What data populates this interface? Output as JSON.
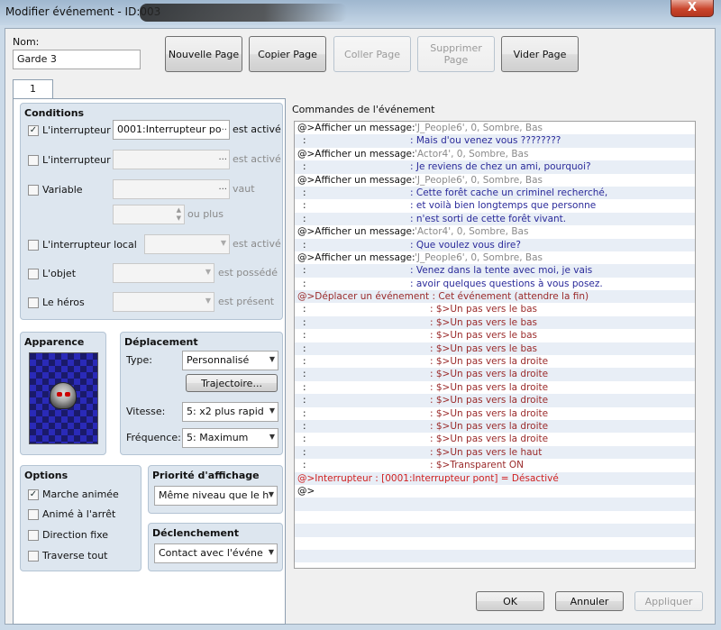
{
  "window": {
    "title": "Modifier événement - ID:003",
    "close": "X"
  },
  "name_field": {
    "label": "Nom:",
    "value": "Garde 3"
  },
  "top_buttons": [
    {
      "label": "Nouvelle Page",
      "enabled": true
    },
    {
      "label": "Copier Page",
      "enabled": true
    },
    {
      "label": "Coller Page",
      "enabled": false
    },
    {
      "label": "Supprimer Page",
      "enabled": false
    },
    {
      "label": "Vider Page",
      "enabled": true
    }
  ],
  "tab": {
    "label": "1"
  },
  "conditions": {
    "title": "Conditions",
    "switch1": {
      "label": "L'interrupteur",
      "value": "0001:Interrupteur po",
      "suffix": "est activé",
      "checked": true
    },
    "switch2": {
      "label": "L'interrupteur",
      "value": "",
      "suffix": "est activé",
      "checked": false
    },
    "variable": {
      "label": "Variable",
      "value": "",
      "suffix": "vaut",
      "suffix2": "ou plus",
      "checked": false
    },
    "self_switch": {
      "label": "L'interrupteur local",
      "value": "",
      "suffix": "est activé",
      "checked": false
    },
    "item": {
      "label": "L'objet",
      "value": "",
      "suffix": "est possédé",
      "checked": false
    },
    "actor": {
      "label": "Le héros",
      "value": "",
      "suffix": "est présent",
      "checked": false
    },
    "dots": "..."
  },
  "appearance": {
    "title": "Apparence"
  },
  "movement": {
    "title": "Déplacement",
    "type_label": "Type:",
    "type_value": "Personnalisé",
    "route_button": "Trajectoire...",
    "speed_label": "Vitesse:",
    "speed_value": "5: x2 plus rapid",
    "freq_label": "Fréquence:",
    "freq_value": "5: Maximum"
  },
  "options": {
    "title": "Options",
    "items": [
      {
        "label": "Marche animée",
        "checked": true
      },
      {
        "label": "Animé à l'arrêt",
        "checked": false
      },
      {
        "label": "Direction fixe",
        "checked": false
      },
      {
        "label": "Traverse tout",
        "checked": false
      }
    ]
  },
  "priority": {
    "title": "Priorité d'affichage",
    "value": "Même niveau que le h"
  },
  "trigger": {
    "title": "Déclenchement",
    "value": "Contact avec l'événe"
  },
  "commands": {
    "label": "Commandes de l'événement",
    "lines": [
      {
        "a": "@>Afficher un message:",
        "b": "'J_People6', 0, Sombre, Bas",
        "kind": "msg"
      },
      {
        "a": ":",
        "b": ": Mais d'ou venez vous ????????",
        "kind": "text"
      },
      {
        "a": "@>Afficher un message:",
        "b": "'Actor4', 0, Sombre, Bas",
        "kind": "msg"
      },
      {
        "a": ":",
        "b": ": Je reviens de chez un ami, pourquoi?",
        "kind": "text"
      },
      {
        "a": "@>Afficher un message:",
        "b": "'J_People6', 0, Sombre, Bas",
        "kind": "msg"
      },
      {
        "a": ":",
        "b": ": Cette forêt cache un criminel recherché,",
        "kind": "text"
      },
      {
        "a": ":",
        "b": ": et voilà bien longtemps que personne",
        "kind": "text"
      },
      {
        "a": ":",
        "b": ": n'est sorti de cette forêt vivant.",
        "kind": "text"
      },
      {
        "a": "@>Afficher un message:",
        "b": "'Actor4', 0, Sombre, Bas",
        "kind": "msg"
      },
      {
        "a": ":",
        "b": ": Que voulez vous dire?",
        "kind": "text"
      },
      {
        "a": "@>Afficher un message:",
        "b": "'J_People6', 0, Sombre, Bas",
        "kind": "msg"
      },
      {
        "a": ":",
        "b": ": Venez dans la tente avec moi, je vais",
        "kind": "text"
      },
      {
        "a": ":",
        "b": ": avoir quelques questions à vous posez.",
        "kind": "text"
      },
      {
        "a": "@>Déplacer un événement : Cet événement (attendre la fin)",
        "b": "",
        "kind": "move"
      },
      {
        "a": ":",
        "b": ": $>Un pas vers le bas",
        "kind": "route"
      },
      {
        "a": ":",
        "b": ": $>Un pas vers le bas",
        "kind": "route"
      },
      {
        "a": ":",
        "b": ": $>Un pas vers le bas",
        "kind": "route"
      },
      {
        "a": ":",
        "b": ": $>Un pas vers le bas",
        "kind": "route"
      },
      {
        "a": ":",
        "b": ": $>Un pas vers la droite",
        "kind": "route"
      },
      {
        "a": ":",
        "b": ": $>Un pas vers la droite",
        "kind": "route"
      },
      {
        "a": ":",
        "b": ": $>Un pas vers la droite",
        "kind": "route"
      },
      {
        "a": ":",
        "b": ": $>Un pas vers la droite",
        "kind": "route"
      },
      {
        "a": ":",
        "b": ": $>Un pas vers la droite",
        "kind": "route"
      },
      {
        "a": ":",
        "b": ": $>Un pas vers la droite",
        "kind": "route"
      },
      {
        "a": ":",
        "b": ": $>Un pas vers la droite",
        "kind": "route"
      },
      {
        "a": ":",
        "b": ": $>Un pas vers le haut",
        "kind": "route"
      },
      {
        "a": ":",
        "b": ": $>Transparent ON",
        "kind": "route"
      },
      {
        "a": "@>Interrupteur : [0001:Interrupteur pont] = Désactivé",
        "b": "",
        "kind": "switch"
      },
      {
        "a": "@>",
        "b": "",
        "kind": "end"
      },
      {
        "a": "",
        "b": "",
        "kind": "blank"
      },
      {
        "a": "",
        "b": "",
        "kind": "blank"
      },
      {
        "a": "",
        "b": "",
        "kind": "blank"
      },
      {
        "a": "",
        "b": "",
        "kind": "blank"
      },
      {
        "a": "",
        "b": "",
        "kind": "blank"
      }
    ]
  },
  "footer": {
    "ok": "OK",
    "cancel": "Annuler",
    "apply": "Appliquer"
  }
}
